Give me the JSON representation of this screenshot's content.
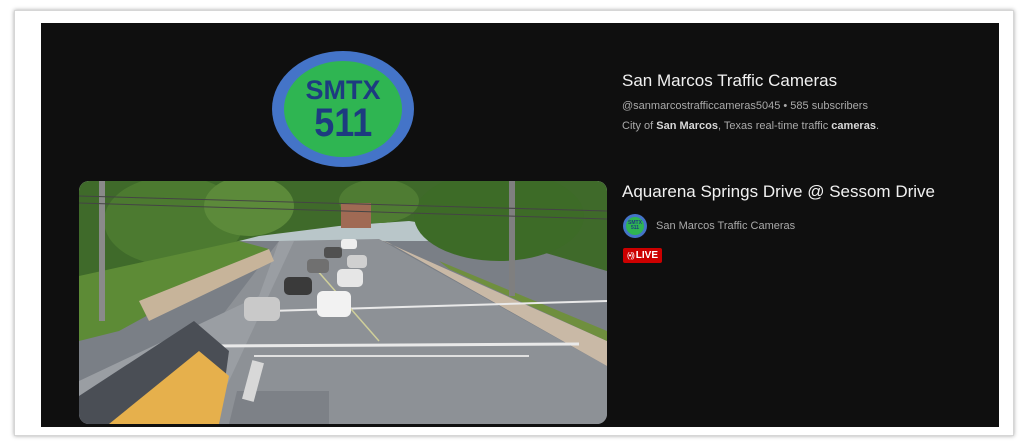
{
  "channel": {
    "logo_line1": "SMTX",
    "logo_line2": "511",
    "name": "San Marcos Traffic Cameras",
    "handle": "@sanmarcostrafficcameras5045",
    "separator": "•",
    "subscribers": "585 subscribers",
    "description_parts": [
      "City of ",
      "San Marcos",
      ", Texas real-time traffic ",
      "cameras",
      "."
    ]
  },
  "video": {
    "title": "Aquarena Springs Drive @ Sessom Drive",
    "channel_name": "San Marcos Traffic Cameras",
    "live_icon": "(•))",
    "live_label": "LIVE"
  },
  "icons": {
    "live": "broadcast-icon",
    "avatar": "channel-avatar"
  },
  "colors": {
    "background": "#0f0f0f",
    "live_red": "#cc0000",
    "logo_blue": "#4474c8",
    "logo_green": "#2fb552"
  }
}
